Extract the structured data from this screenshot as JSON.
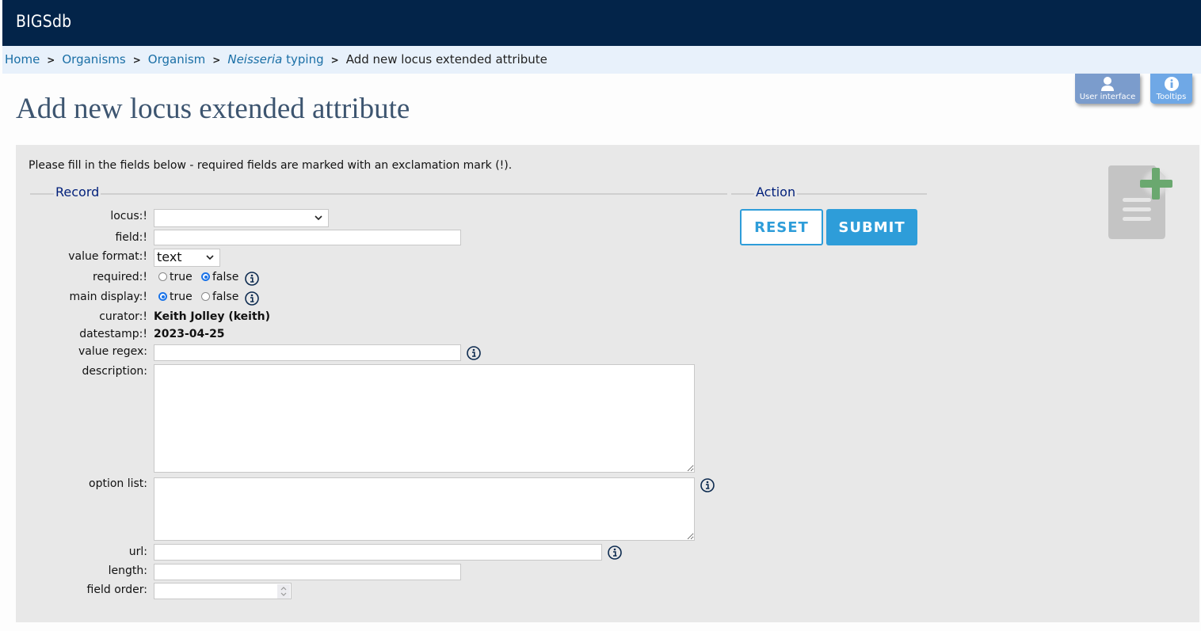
{
  "app": {
    "title": "BIGSdb"
  },
  "breadcrumb": {
    "items": [
      {
        "label": "Home"
      },
      {
        "label": "Organisms"
      },
      {
        "label": "Organism"
      },
      {
        "label_italic": "Neisseria",
        "label": "typing"
      }
    ],
    "current": "Add new locus extended attribute",
    "separator": ">"
  },
  "toolbar": {
    "user_interface": "User interface",
    "tooltips": "Tooltips"
  },
  "page": {
    "title": "Add new locus extended attribute",
    "intro": "Please fill in the fields below - required fields are marked with an exclamation mark (!)."
  },
  "form": {
    "record_legend": "Record",
    "action_legend": "Action",
    "fields": {
      "locus": {
        "label": "locus:!",
        "value": ""
      },
      "field": {
        "label": "field:!",
        "value": ""
      },
      "value_format": {
        "label": "value format:!",
        "value": "text"
      },
      "required": {
        "label": "required:!",
        "options": [
          "true",
          "false"
        ],
        "selected": "false"
      },
      "main_display": {
        "label": "main display:!",
        "options": [
          "true",
          "false"
        ],
        "selected": "true"
      },
      "curator": {
        "label": "curator:!",
        "value": "Keith Jolley (keith)"
      },
      "datestamp": {
        "label": "datestamp:!",
        "value": "2023-04-25"
      },
      "value_regex": {
        "label": "value regex:",
        "value": ""
      },
      "description": {
        "label": "description:",
        "value": ""
      },
      "option_list": {
        "label": "option list:",
        "value": ""
      },
      "url": {
        "label": "url:",
        "value": ""
      },
      "length": {
        "label": "length:",
        "value": ""
      },
      "field_order": {
        "label": "field order:",
        "value": ""
      }
    },
    "buttons": {
      "reset": "RESET",
      "submit": "SUBMIT"
    }
  },
  "colors": {
    "topbar": "#032449",
    "accent": "#2e9dd9",
    "legend": "#001f7a",
    "add_icon_plus": "#6aa86f"
  }
}
